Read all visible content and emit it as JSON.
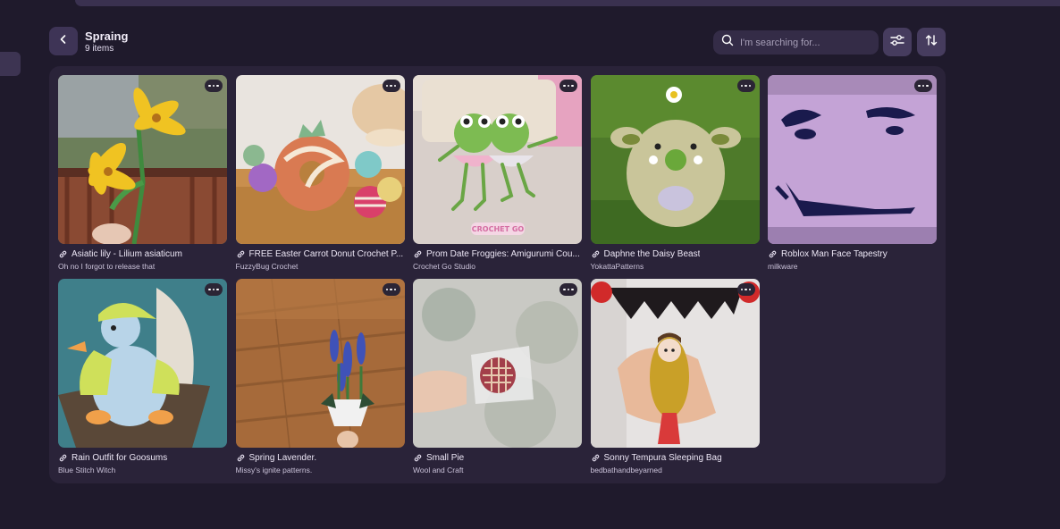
{
  "collection": {
    "title": "Spraing",
    "count": "9 items"
  },
  "search": {
    "placeholder": "I'm searching for...",
    "value": ""
  },
  "icons": {
    "back": "chevron-left-icon",
    "search": "search-icon",
    "filter": "sliders-icon",
    "sort": "sort-icon",
    "more": "more-horizontal-icon",
    "link": "link-icon"
  },
  "colors": {
    "background": "#1f1a2c",
    "panel": "#2a2339",
    "button": "#463c5e"
  },
  "patterns": [
    {
      "title": "Asiatic lily - Lilium asiaticum",
      "author": "Oh no I forgot to release that"
    },
    {
      "title": "FREE Easter Carrot Donut Crochet P...",
      "author": "FuzzyBug Crochet"
    },
    {
      "title": "Prom Date Froggies: Amigurumi Cou...",
      "author": "Crochet Go Studio"
    },
    {
      "title": "Daphne the Daisy Beast",
      "author": "YokattaPatterns"
    },
    {
      "title": "Roblox Man Face Tapestry",
      "author": "milkware"
    },
    {
      "title": "Rain Outfit for Goosums",
      "author": "Blue Stitch Witch"
    },
    {
      "title": "Spring Lavender.",
      "author": "Missy's ignite patterns."
    },
    {
      "title": "Small Pie",
      "author": "Wool and Craft"
    },
    {
      "title": "Sonny Tempura Sleeping Bag",
      "author": "bedbathandbeyarned"
    }
  ]
}
